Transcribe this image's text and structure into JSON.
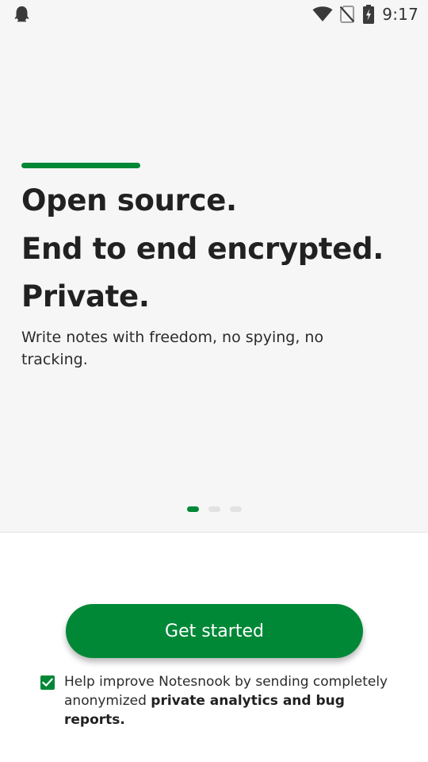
{
  "status_bar": {
    "time": "9:17",
    "left_icon": "ghost-notification-icon",
    "icons": [
      "wifi-icon",
      "no-sim-icon",
      "battery-charging-icon"
    ]
  },
  "onboarding": {
    "headline": [
      "Open source.",
      "End to end encrypted.",
      "Private."
    ],
    "subtitle": "Write notes with freedom, no spying, no tracking.",
    "pager": {
      "total": 3,
      "active_index": 0
    }
  },
  "actions": {
    "get_started_label": "Get started"
  },
  "consent": {
    "checked": true,
    "text": "Help improve Notesnook by sending completely anonymized ",
    "link_text": "private analytics and bug reports."
  },
  "colors": {
    "accent": "#008837",
    "top_background": "#f6f6f6",
    "bottom_background": "#ffffff",
    "text": "#212121",
    "dot_inactive": "#e2e2e2"
  }
}
